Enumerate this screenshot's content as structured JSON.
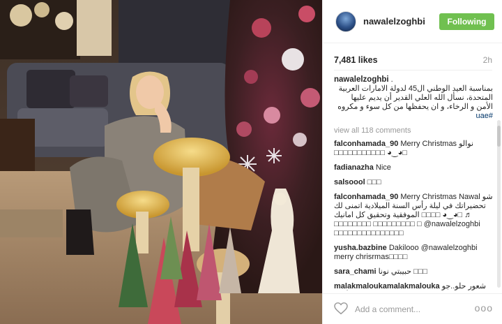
{
  "post": {
    "username": "nawalelzoghbi",
    "follow_label": "Following",
    "likes": "7,481 likes",
    "time": "2h"
  },
  "caption": {
    "user": "nawalelzoghbi",
    "trail": ".",
    "text": "بمناسبة العيد الوطني ال45 لدولة الامارات العربية المتحدة، نسأل الله العلي القدير أن يديم عليها الأمن و الرخاء، و ان يحفظها من كل سوء و مكروه",
    "hashtag": "#uae"
  },
  "view_all": "view all 118 comments",
  "comments": [
    {
      "user": "falconhamada_90",
      "text": "Merry Christmas نوالو",
      "extra": "□□□□□□□□□□□ ◕‿◕□"
    },
    {
      "user": "fadianazha",
      "text": "Nice"
    },
    {
      "user": "salsoool",
      "text": "□□□"
    },
    {
      "user": "falconhamada_90",
      "text": "Merry Christmas Nawal شو تحضيراتك في ليلة رأس السنة الميلادية اتمنى لك الموفقية وتحقيق كل امانيك □□□□ ◕‿◕□ ♬ □□□□□□□□ □□□□□□□□□ □ @nawalelzoghbi □□□□□□□□□□□□□□□"
    },
    {
      "user": "yusha.bazbine",
      "text": "Dakilooo @nawalelzoghbi merry chrisrmas□□□□"
    },
    {
      "user": "sara_chami",
      "text": "حبيبتي نونا □□□"
    },
    {
      "user": "malakmaloukamalakmalouka",
      "text": "شعور حلو..جو الأعياد"
    }
  ],
  "footer": {
    "placeholder": "Add a comment...",
    "more": "ooo"
  },
  "colors": {
    "follow_bg": "#70c050",
    "link": "#003569",
    "muted": "#999999"
  },
  "icons": [
    "heart-icon",
    "more-options-icon",
    "avatar"
  ]
}
